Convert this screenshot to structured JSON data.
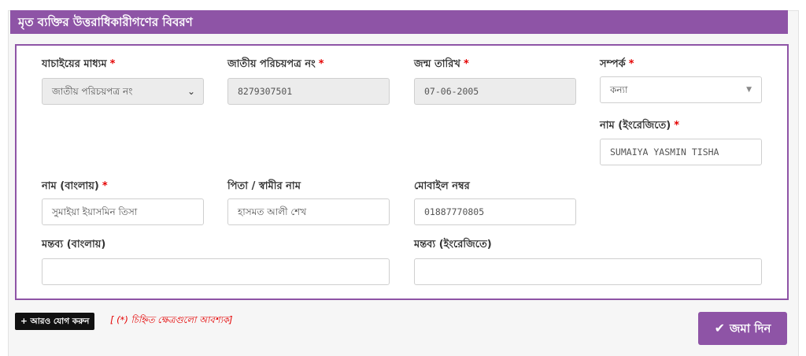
{
  "section": {
    "title": "মৃত ব্যক্তির উত্তরাধিকারীগণের বিবরণ"
  },
  "form": {
    "verification_method": {
      "label": "যাচাইয়ের মাধ্যম",
      "required_mark": "*",
      "selected": "জাতীয় পরিচয়পত্র নং"
    },
    "nid": {
      "label": "জাতীয় পরিচয়পত্র নং",
      "required_mark": "*",
      "value": "8279307501"
    },
    "dob": {
      "label": "জন্ম তারিখ",
      "required_mark": "*",
      "value": "07-06-2005"
    },
    "relation": {
      "label": "সম্পর্ক",
      "required_mark": "*",
      "selected": "কন্যা"
    },
    "name_en": {
      "label": "নাম (ইংরেজিতে)",
      "required_mark": "*",
      "value": "SUMAIYA YASMIN TISHA"
    },
    "name_bn": {
      "label": "নাম (বাংলায়)",
      "required_mark": "*",
      "value": "সুমাইয়া ইয়াসমিন তিসা"
    },
    "father_husband": {
      "label": "পিতা / স্বামীর নাম",
      "value": "হাসমত আলী শেখ"
    },
    "mobile": {
      "label": "মোবাইল নম্বর",
      "value": "01887770805"
    },
    "remarks_bn": {
      "label": "মন্তব্য (বাংলায়)",
      "value": ""
    },
    "remarks_en": {
      "label": "মন্তব্য (ইংরেজিতে)",
      "value": ""
    }
  },
  "actions": {
    "add_more_label": "+ আরও যোগ করুন",
    "required_note": "[ (*) চিহ্নিত ক্ষেত্রগুলো আবশ্যক]",
    "submit_label": "জমা দিন",
    "submit_icon": "check-icon"
  },
  "colors": {
    "accent": "#8e54a6",
    "required": "#e40000"
  }
}
